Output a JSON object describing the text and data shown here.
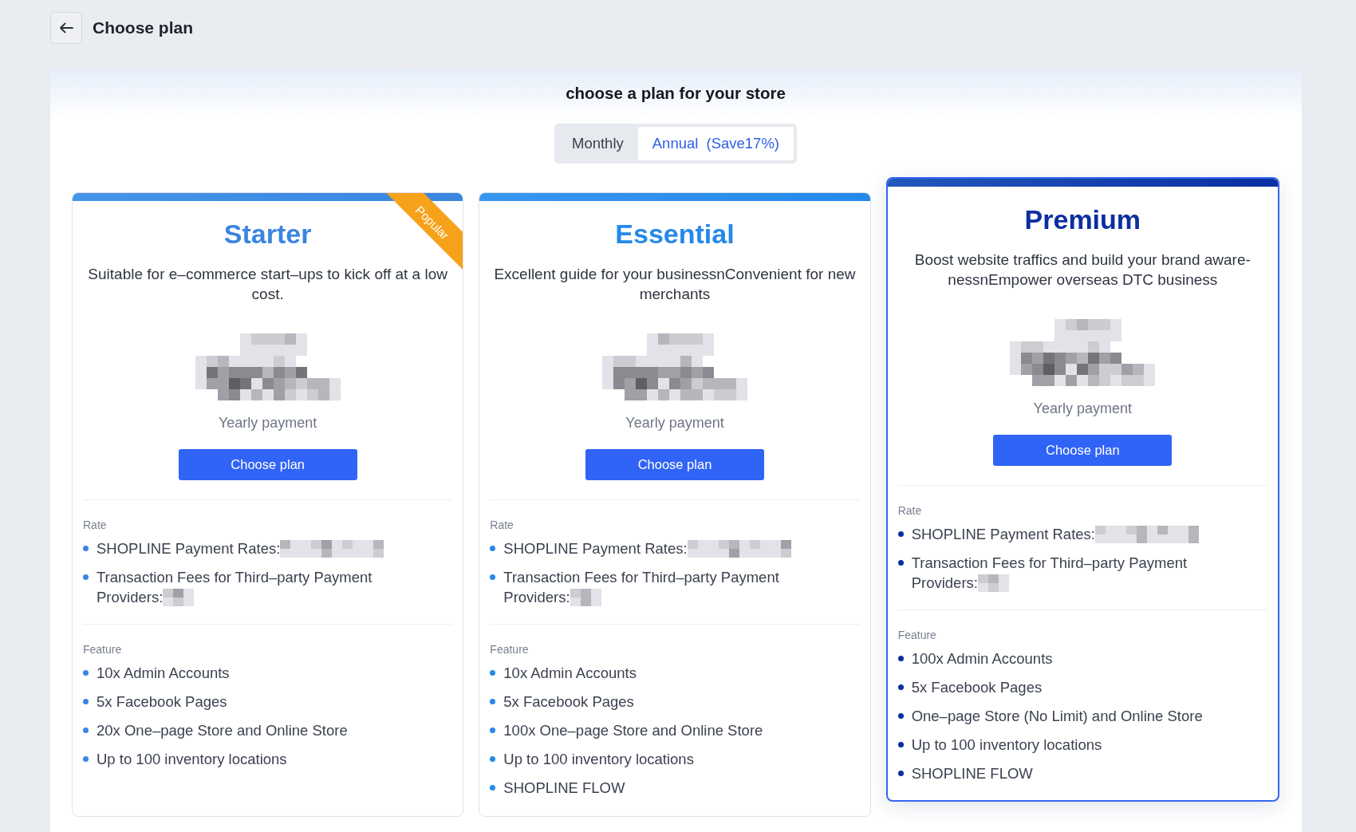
{
  "header": {
    "title": "Choose plan"
  },
  "heading": "choose a plan for your store",
  "billing_options": [
    {
      "label": "Monthly",
      "selected": false
    },
    {
      "label": "Annual",
      "note": "(Save17%)",
      "selected": true
    }
  ],
  "plans": [
    {
      "name": "Starter",
      "color": "#3a86e0",
      "badge": "Popular",
      "selected": false,
      "description": "Suitable for e–commerce start–ups to kick off at a low cost.",
      "price_redacted": true,
      "period": "Yearly payment",
      "button": "Choose plan",
      "rate_label": "Rate",
      "rates": [
        {
          "label": "SHOPLINE Payment Rates:",
          "redacted": true
        },
        {
          "label": "Transaction Fees for Third–party Payment Providers:",
          "redacted": true
        }
      ],
      "feature_label": "Feature",
      "features": [
        "10x Admin Accounts",
        "5x Facebook Pages",
        "20x One–page Store and Online Store",
        "Up to 100 inventory locations"
      ]
    },
    {
      "name": "Essential",
      "color": "#2589ea",
      "selected": false,
      "description": "Excellent guide for your businessnConvenient for new merchants",
      "price_redacted": true,
      "period": "Yearly payment",
      "button": "Choose plan",
      "rate_label": "Rate",
      "rates": [
        {
          "label": "SHOPLINE Payment Rates:",
          "redacted": true
        },
        {
          "label": "Transaction Fees for Third–party Payment Providers:",
          "redacted": true
        }
      ],
      "feature_label": "Feature",
      "features": [
        "10x Admin Accounts",
        "5x Facebook Pages",
        "100x One–page Store and Online Store",
        "Up to 100 inventory locations",
        "SHOPLINE FLOW"
      ]
    },
    {
      "name": "Premium",
      "color": "#0b2ea0",
      "selected": true,
      "description": "Boost website traffics and build your brand aware-nessnEmpower overseas DTC business",
      "price_redacted": true,
      "period": "Yearly payment",
      "button": "Choose plan",
      "rate_label": "Rate",
      "rates": [
        {
          "label": "SHOPLINE Payment Rates:",
          "redacted": true
        },
        {
          "label": "Transaction Fees for Third–party Payment Providers:",
          "redacted": true
        }
      ],
      "feature_label": "Feature",
      "features": [
        "100x Admin Accounts",
        "5x Facebook Pages",
        "One–page Store (No Limit) and Online Store",
        "Up to 100 inventory locations",
        "SHOPLINE FLOW"
      ]
    }
  ]
}
